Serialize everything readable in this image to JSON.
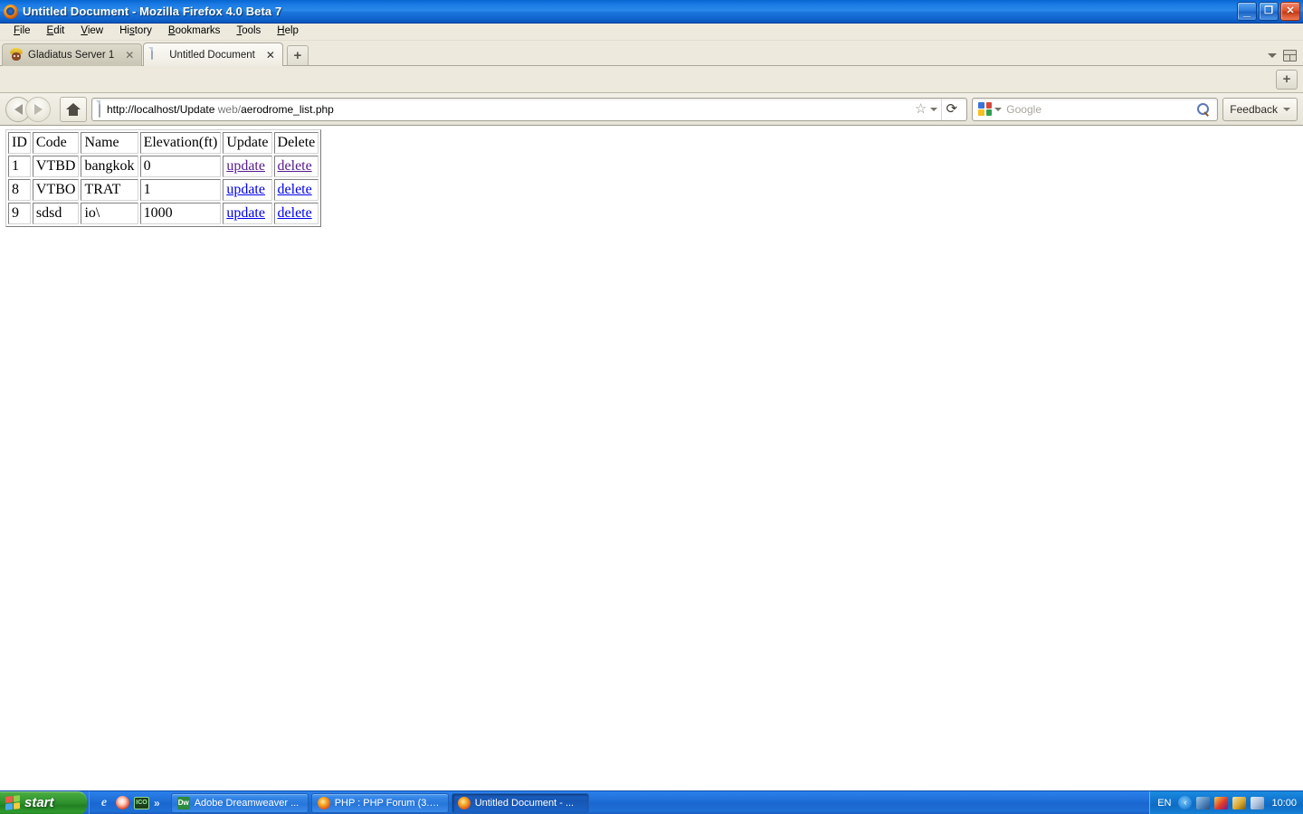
{
  "window": {
    "title": "Untitled Document - Mozilla Firefox 4.0 Beta 7",
    "icon": "firefox-icon",
    "minimize_label": "_",
    "restore_label": "❐",
    "close_label": "✕"
  },
  "menubar": {
    "items": [
      {
        "label": "File",
        "accel": "F"
      },
      {
        "label": "Edit",
        "accel": "E"
      },
      {
        "label": "View",
        "accel": "V"
      },
      {
        "label": "History",
        "accel": "s"
      },
      {
        "label": "Bookmarks",
        "accel": "B"
      },
      {
        "label": "Tools",
        "accel": "T"
      },
      {
        "label": "Help",
        "accel": "H"
      }
    ]
  },
  "tabs": {
    "items": [
      {
        "label": "Gladiatus Server 1",
        "favicon": "gladiator-icon",
        "active": false,
        "close_label": "✕"
      },
      {
        "label": "Untitled Document",
        "favicon": "document-icon",
        "active": true,
        "close_label": "✕"
      }
    ],
    "new_tab_label": "+",
    "all_tabs_label": "List all tabs"
  },
  "bookmarks_toolbar": {
    "add_label": "+"
  },
  "navbar": {
    "back_label": "Back",
    "forward_label": "Forward",
    "home_label": "Home",
    "url_protocol_host": "http://localhost/Update",
    "url_path_dim": " web/",
    "url_path_rest": "aerodrome_list.php",
    "url_full": "http://localhost/Update web/aerodrome_list.php",
    "bookmark_star": "☆",
    "reload_label": "⟳",
    "search_engine": "Google",
    "search_placeholder": "Google",
    "search_value": "",
    "feedback_label": "Feedback"
  },
  "page": {
    "table": {
      "headers": [
        "ID",
        "Code",
        "Name",
        "Elevation(ft)",
        "Update",
        "Delete"
      ],
      "rows": [
        {
          "id": "1",
          "code": "VTBD",
          "name": "bangkok",
          "elevation": "0",
          "update_label": "update",
          "delete_label": "delete",
          "visited": true
        },
        {
          "id": "8",
          "code": "VTBO",
          "name": "TRAT",
          "elevation": "1",
          "update_label": "update",
          "delete_label": "delete",
          "visited": false
        },
        {
          "id": "9",
          "code": "sdsd",
          "name": "io\\",
          "elevation": "1000",
          "update_label": "update",
          "delete_label": "delete",
          "visited": false
        }
      ]
    }
  },
  "taskbar": {
    "start_label": "start",
    "quicklaunch": [
      {
        "name": "internet-explorer-icon",
        "label": "e"
      },
      {
        "name": "firefox-icon",
        "label": ""
      },
      {
        "name": "ico-tool-icon",
        "label": "ICO"
      }
    ],
    "overflow_label": "»",
    "tasks": [
      {
        "label": "Adobe Dreamweaver ...",
        "icon": "dreamweaver-icon",
        "icon_label": "Dw",
        "active": false
      },
      {
        "label": "PHP : PHP Forum (3.0...",
        "icon": "firefox-icon",
        "icon_label": "",
        "active": false
      },
      {
        "label": "Untitled Document - ...",
        "icon": "firefox-icon",
        "icon_label": "",
        "active": true
      }
    ],
    "tray": {
      "language": "EN",
      "expand_label": "‹",
      "icons": [
        "network-icon",
        "media-icon",
        "display-icon",
        "mail-icon"
      ],
      "clock": "10:00"
    }
  },
  "colors": {
    "titlebar_blue": "#1b7ae4",
    "taskbar_blue": "#1f6fd8",
    "start_green": "#2d8f2b",
    "link_blue": "#0000ee",
    "link_visited": "#551a8b",
    "chrome_bg": "#edeadd"
  }
}
